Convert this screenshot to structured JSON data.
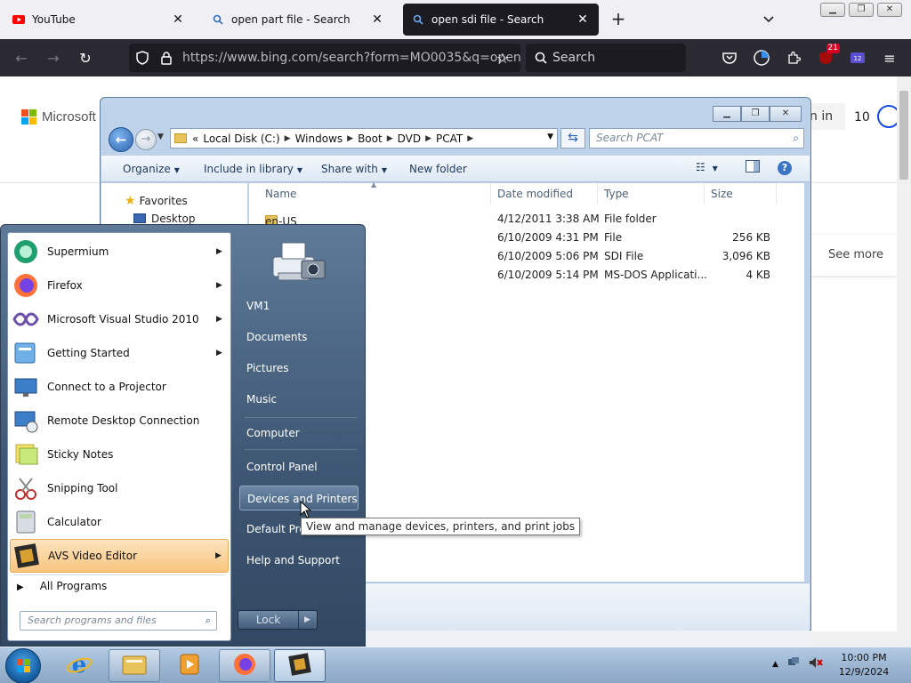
{
  "browser": {
    "tabs": [
      {
        "label": "YouTube",
        "icon": "youtube-icon"
      },
      {
        "label": "open part file - Search",
        "icon": "search-icon"
      },
      {
        "label": "open sdi file - Search",
        "icon": "search-icon",
        "active": true
      }
    ],
    "url": "https://www.bing.com/search?form=MO0035&q=open",
    "search_placeholder": "Search",
    "extension_badge": "21"
  },
  "bing": {
    "logo_text": "Microsoft",
    "signin_label": "n in",
    "points": "10",
    "see_more": "See more"
  },
  "explorer": {
    "address": {
      "lead": "«",
      "segments": [
        "Local Disk (C:)",
        "Windows",
        "Boot",
        "DVD",
        "PCAT"
      ]
    },
    "search_placeholder": "Search PCAT",
    "commands": {
      "organize": "Organize",
      "include": "Include in library",
      "share": "Share with",
      "new_folder": "New folder"
    },
    "nav": {
      "favorites": "Favorites",
      "desktop": "Desktop"
    },
    "columns": {
      "name": "Name",
      "date": "Date modified",
      "type": "Type",
      "size": "Size"
    },
    "files": [
      {
        "name": "en-US",
        "date": "4/12/2011 3:38 AM",
        "type": "File folder",
        "size": ""
      },
      {
        "name": "",
        "date": "6/10/2009 4:31 PM",
        "type": "File",
        "size": "256 KB"
      },
      {
        "name": "",
        "date": "6/10/2009 5:06 PM",
        "type": "SDI File",
        "size": "3,096 KB"
      },
      {
        "name": "",
        "date": "6/10/2009 5:14 PM",
        "type": "MS-DOS Applicati...",
        "size": "4 KB"
      }
    ]
  },
  "start_menu": {
    "programs": [
      {
        "label": "Supermium",
        "has_submenu": true
      },
      {
        "label": "Firefox",
        "has_submenu": true
      },
      {
        "label": "Microsoft Visual Studio 2010",
        "has_submenu": true
      },
      {
        "label": "Getting Started",
        "has_submenu": true
      },
      {
        "label": "Connect to a Projector",
        "has_submenu": false
      },
      {
        "label": "Remote Desktop Connection",
        "has_submenu": false
      },
      {
        "label": "Sticky Notes",
        "has_submenu": false
      },
      {
        "label": "Snipping Tool",
        "has_submenu": false
      },
      {
        "label": "Calculator",
        "has_submenu": false
      },
      {
        "label": "AVS Video Editor",
        "has_submenu": true,
        "highlighted": true
      }
    ],
    "all_programs": "All Programs",
    "search_placeholder": "Search programs and files",
    "right_items": [
      {
        "label": "VM1"
      },
      {
        "label": "Documents"
      },
      {
        "label": "Pictures"
      },
      {
        "label": "Music"
      },
      {
        "label": "Computer"
      },
      {
        "label": "Control Panel"
      },
      {
        "label": "Devices and Printers",
        "highlighted": true
      },
      {
        "label": "Default Pro"
      },
      {
        "label": "Help and Support"
      }
    ],
    "lock_label": "Lock",
    "tooltip": "View and manage devices, printers, and print jobs"
  },
  "taskbar": {
    "time": "10:00 PM",
    "date": "12/9/2024"
  },
  "colors": {
    "taskbar": "#9db7d3",
    "start_menu_right": "#3f5875",
    "highlight": "#f9c57e",
    "browser_dark": "#2b2a33"
  }
}
